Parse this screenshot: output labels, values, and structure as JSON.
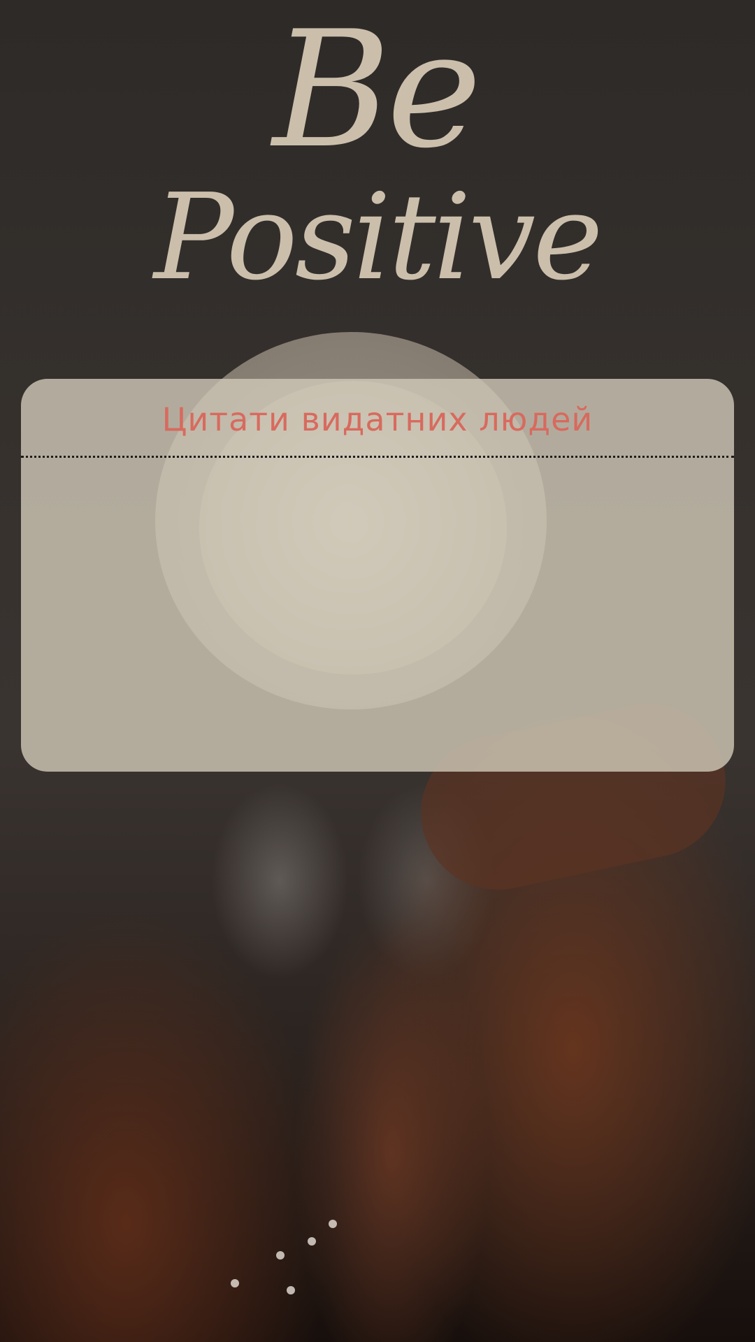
{
  "hero": {
    "line1": "Be",
    "line2": "Positive"
  },
  "quote_card": {
    "title": "Цитати видатних людей"
  },
  "colors": {
    "hero_text": "#cbbfac",
    "card_bg": "#cec7b6",
    "card_title": "#d86a5e",
    "divider": "#1e1c1a"
  }
}
